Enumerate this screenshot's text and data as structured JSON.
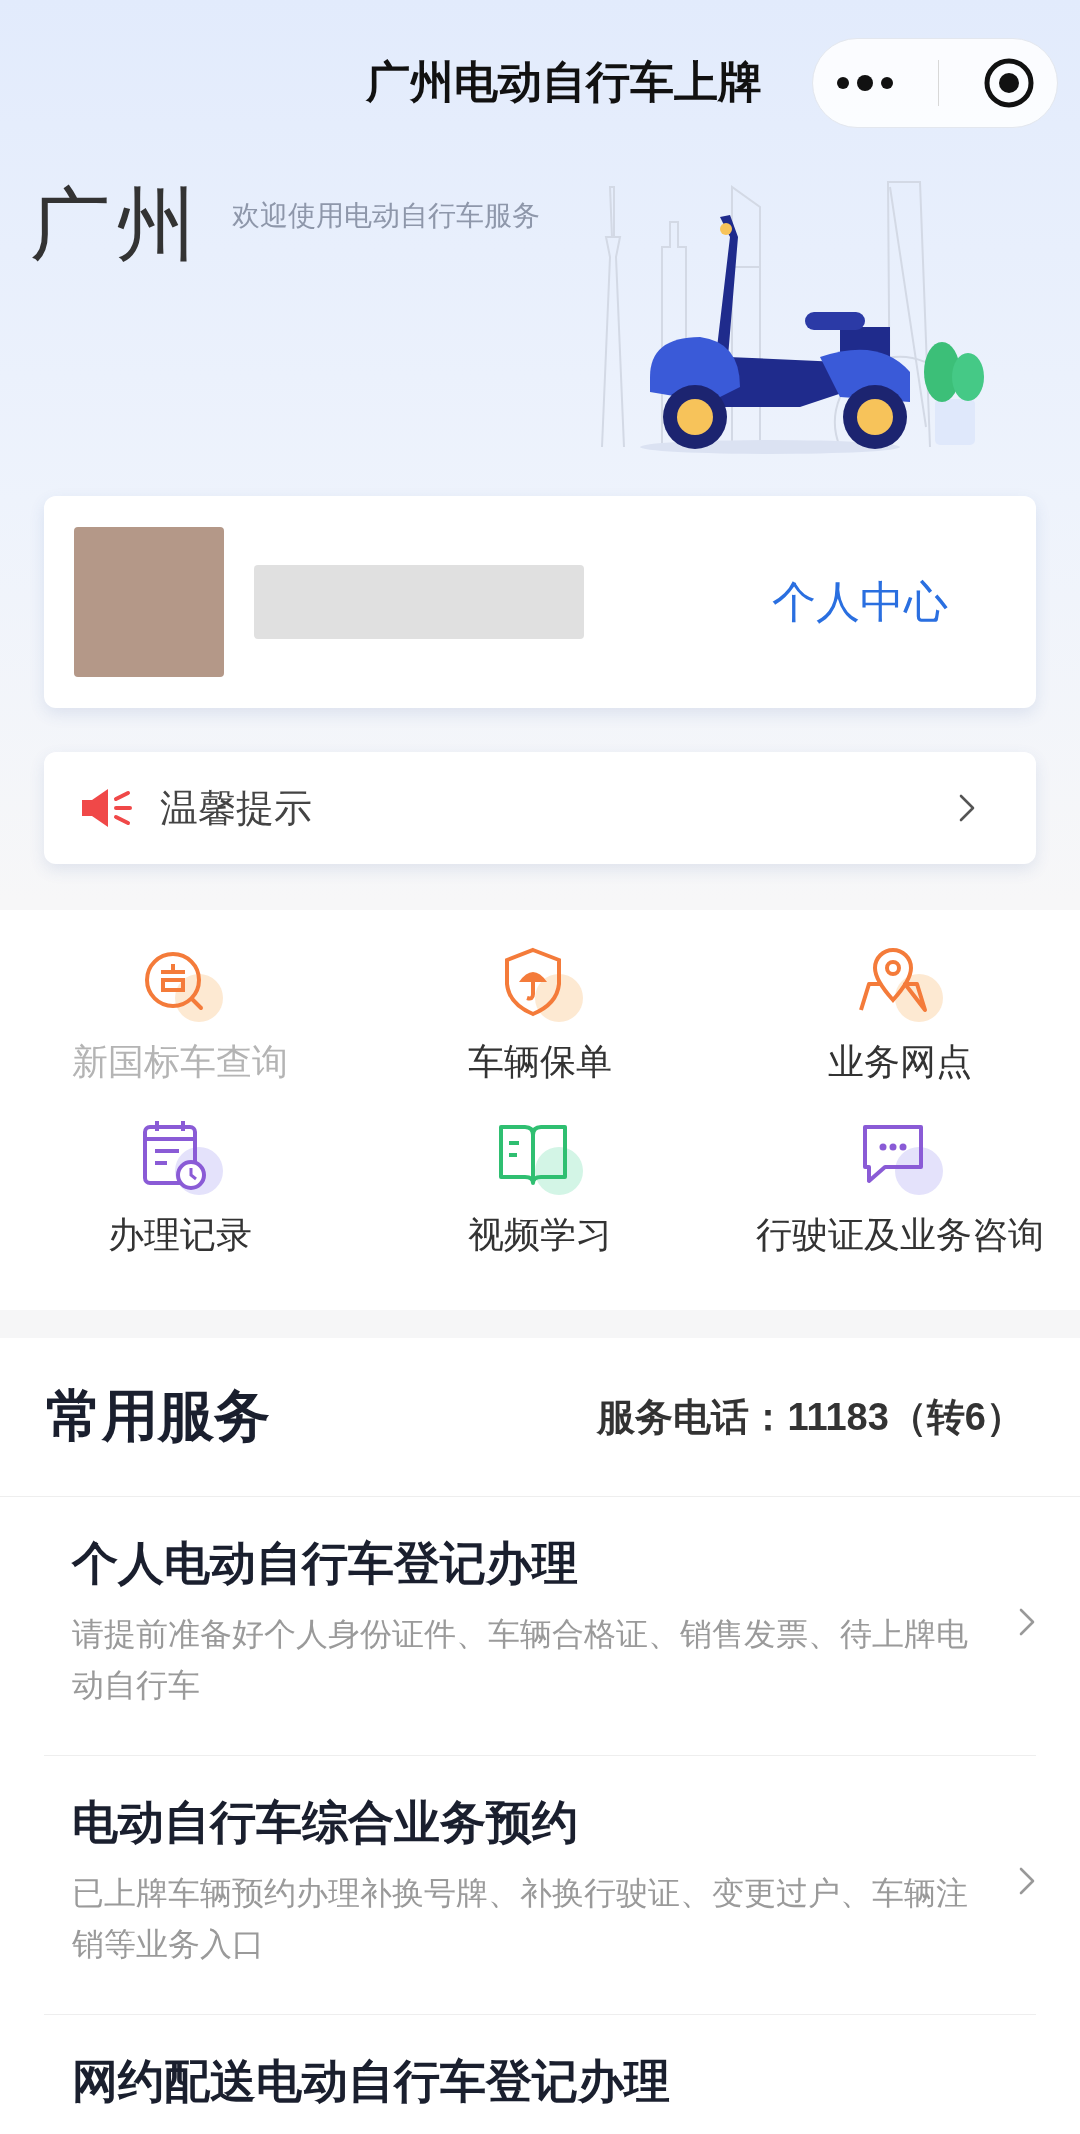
{
  "nav": {
    "title": "广州电动自行车上牌"
  },
  "hero": {
    "city": "广州",
    "welcome": "欢迎使用电动自行车服务"
  },
  "user_card": {
    "link": "个人中心"
  },
  "notice": {
    "label": "温馨提示"
  },
  "shortcuts": [
    {
      "label": "新国标车查询",
      "kind": "search",
      "color": "#f47b3a",
      "disabled": true
    },
    {
      "label": "车辆保单",
      "kind": "shield",
      "color": "#f47b3a",
      "disabled": false
    },
    {
      "label": "业务网点",
      "kind": "pin",
      "color": "#f47b3a",
      "disabled": false
    },
    {
      "label": "办理记录",
      "kind": "calendar",
      "color": "#8a5bd6",
      "disabled": false
    },
    {
      "label": "视频学习",
      "kind": "book",
      "color": "#2fbf71",
      "disabled": false
    },
    {
      "label": "行驶证及业务咨询",
      "kind": "chat",
      "color": "#8a5bd6",
      "disabled": false
    }
  ],
  "services_header": {
    "title": "常用服务",
    "phone": "服务电话：11183（转6）"
  },
  "services": [
    {
      "title": "个人电动自行车登记办理",
      "description": "请提前准备好个人身份证件、车辆合格证、销售发票、待上牌电动自行车"
    },
    {
      "title": "电动自行车综合业务预约",
      "description": "已上牌车辆预约办理补换号牌、补换行驶证、变更过户、车辆注销等业务入口"
    },
    {
      "title": "网约配送电动自行车登记办理"
    }
  ]
}
